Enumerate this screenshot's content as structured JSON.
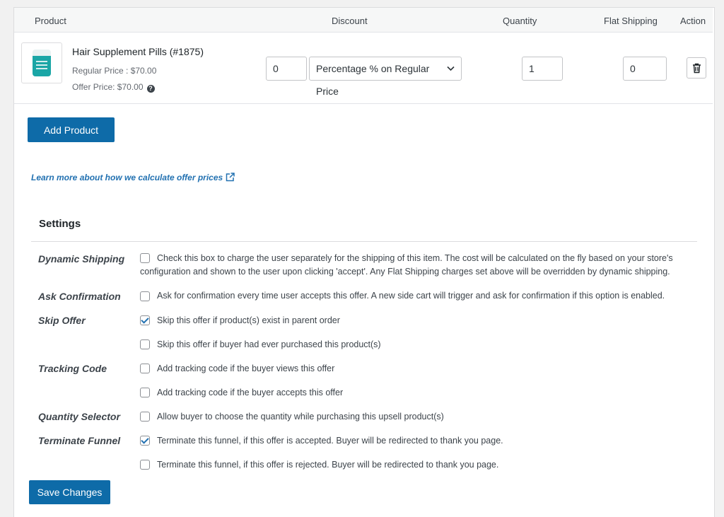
{
  "table": {
    "headers": {
      "product": "Product",
      "discount": "Discount",
      "quantity": "Quantity",
      "flat_shipping": "Flat Shipping",
      "action": "Action"
    },
    "product": {
      "name": "Hair Supplement Pills (#1875)",
      "regular_price": "Regular Price : $70.00",
      "offer_price": "Offer Price: $70.00",
      "discount_value": "0",
      "discount_type": "Percentage % on Regular Price",
      "quantity": "1",
      "flat_shipping": "0"
    }
  },
  "add_product_label": "Add Product",
  "learn_more_link": "Learn more about how we calculate offer prices",
  "settings": {
    "title": "Settings",
    "dynamic_shipping": {
      "label": "Dynamic Shipping",
      "text_line1": "Check this box to charge the user separately for the shipping of this item. The cost will be calculated on the fly based on your store's",
      "text_line2": "configuration and shown to the user upon clicking 'accept'. Any Flat Shipping charges set above will be overridden by dynamic shipping.",
      "checked": false
    },
    "ask_confirmation": {
      "label": "Ask Confirmation",
      "text": "Ask for confirmation every time user accepts this offer. A new side cart will trigger and ask for confirmation if this option is enabled.",
      "checked": false
    },
    "skip_offer": {
      "label": "Skip Offer",
      "opt1": "Skip this offer if product(s) exist in parent order",
      "opt1_checked": true,
      "opt2": "Skip this offer if buyer had ever purchased this product(s)",
      "opt2_checked": false
    },
    "tracking_code": {
      "label": "Tracking Code",
      "opt1": "Add tracking code if the buyer views this offer",
      "opt1_checked": false,
      "opt2": "Add tracking code if the buyer accepts this offer",
      "opt2_checked": false
    },
    "quantity_selector": {
      "label": "Quantity Selector",
      "text": "Allow buyer to choose the quantity while purchasing this upsell product(s)",
      "checked": false
    },
    "terminate_funnel": {
      "label": "Terminate Funnel",
      "opt1": "Terminate this funnel, if this offer is accepted. Buyer will be redirected to thank you page.",
      "opt1_checked": true,
      "opt2": "Terminate this funnel, if this offer is rejected. Buyer will be redirected to thank you page.",
      "opt2_checked": false
    }
  },
  "save_changes_label": "Save Changes",
  "icons": {
    "help": "help-icon",
    "dropdown": "chevron-down-icon",
    "delete": "trash-icon",
    "external": "external-link-icon"
  },
  "colors": {
    "primary": "#0e6ba8",
    "link": "#2271b1"
  }
}
